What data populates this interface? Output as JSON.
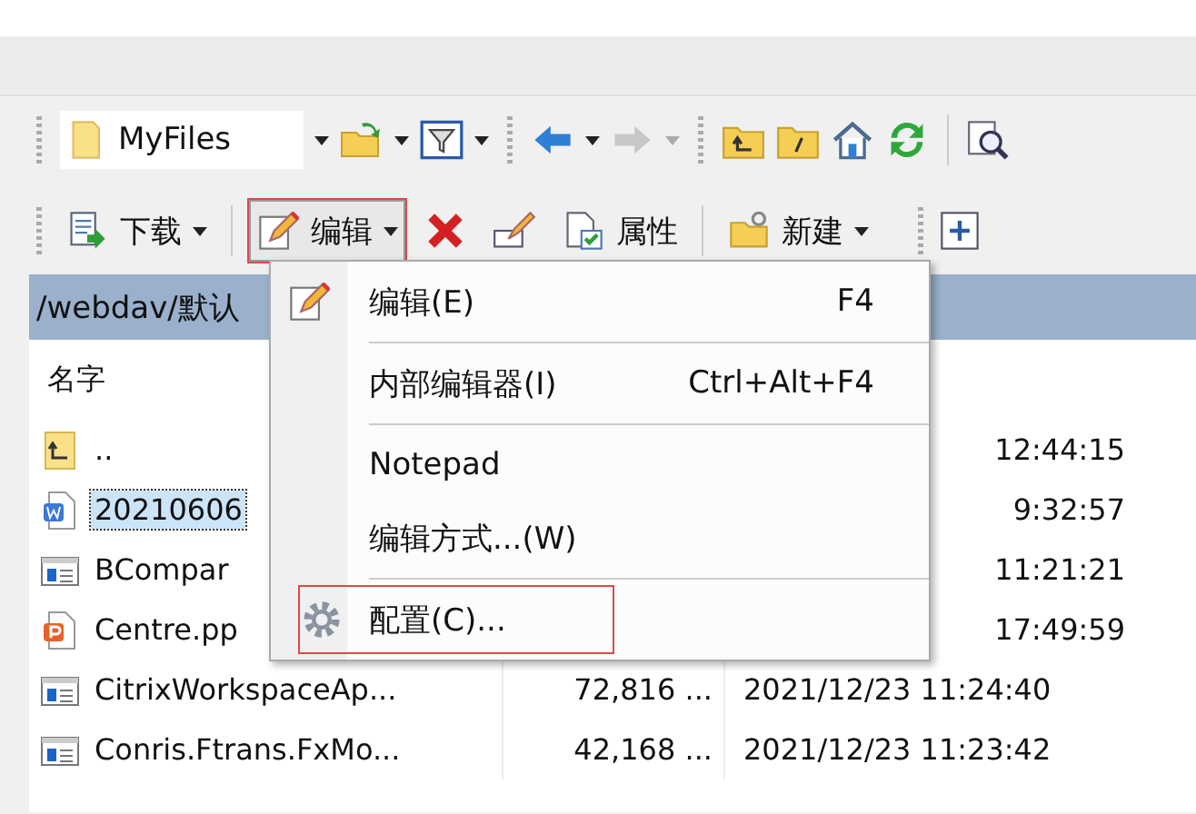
{
  "location_combo": {
    "value": "MyFiles"
  },
  "toolbar": [
    {
      "kind": "download",
      "label": "下载",
      "selected": false
    },
    {
      "kind": "edit",
      "label": "编辑",
      "selected": true
    },
    {
      "kind": "delete",
      "selected": false
    },
    {
      "kind": "rename",
      "selected": false
    },
    {
      "kind": "properties",
      "label": "属性",
      "selected": false
    },
    {
      "kind": "new",
      "label": "新建",
      "selected": false
    }
  ],
  "path_bar": {
    "text": "/webdav/默认"
  },
  "file_list": {
    "columns": [
      {
        "label": "名字"
      }
    ],
    "rows": [
      {
        "kind": "parent",
        "name": "..",
        "modified": "12:44:15",
        "selected": false
      },
      {
        "kind": "word",
        "name": "20210606",
        "modified": "9:32:57",
        "selected": true
      },
      {
        "kind": "app",
        "name": "BCompar",
        "modified": "11:21:21",
        "selected": false
      },
      {
        "kind": "ppt",
        "name": "Centre.pp",
        "modified": "17:49:59",
        "selected": false
      },
      {
        "kind": "app",
        "name": "CitrixWorkspaceAp...",
        "size": "72,816 ...",
        "modified": "2021/12/23 11:24:40",
        "selected": false
      },
      {
        "kind": "app",
        "name": "Conris.Ftrans.FxMo...",
        "size": "42,168 ...",
        "modified": "2021/12/23 11:23:42",
        "selected": false
      }
    ]
  },
  "context_menu": {
    "items": [
      {
        "kind": "item",
        "label": "编辑(E)",
        "shortcut": "F4",
        "highlighted": false
      },
      {
        "kind": "separator"
      },
      {
        "kind": "item",
        "label": "内部编辑器(I)",
        "shortcut": "Ctrl+Alt+F4",
        "highlighted": false
      },
      {
        "kind": "separator"
      },
      {
        "kind": "item",
        "label": "Notepad",
        "highlighted": false
      },
      {
        "kind": "item",
        "label": "编辑方式...(W)",
        "highlighted": false
      },
      {
        "kind": "separator"
      },
      {
        "kind": "item",
        "label": "配置(C)...",
        "highlighted": true
      }
    ]
  }
}
